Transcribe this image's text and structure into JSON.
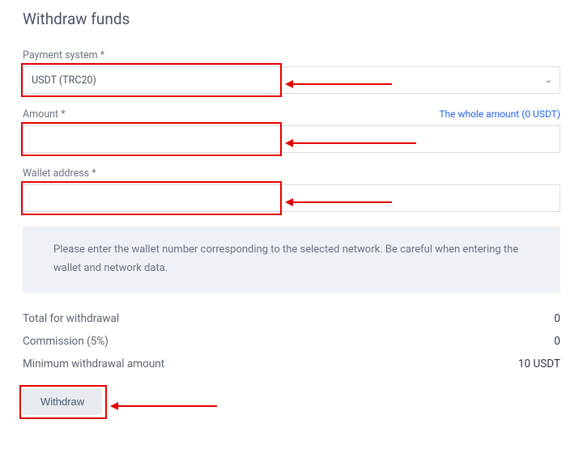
{
  "title": "Withdraw funds",
  "fields": {
    "payment_system": {
      "label": "Payment system *",
      "value": "USDT (TRC20)"
    },
    "amount": {
      "label": "Amount *",
      "whole_link": "The whole amount (0 USDT)",
      "value": ""
    },
    "wallet": {
      "label": "Wallet address *",
      "value": ""
    }
  },
  "info": "Please enter the wallet number corresponding to the selected network. Be careful when entering the wallet and network data.",
  "summary": {
    "total_label": "Total for withdrawal",
    "total_value": "0",
    "commission_label": "Commission (5%)",
    "commission_value": "0",
    "min_label": "Minimum withdrawal amount",
    "min_value": "10 USDT"
  },
  "button": "Withdraw"
}
